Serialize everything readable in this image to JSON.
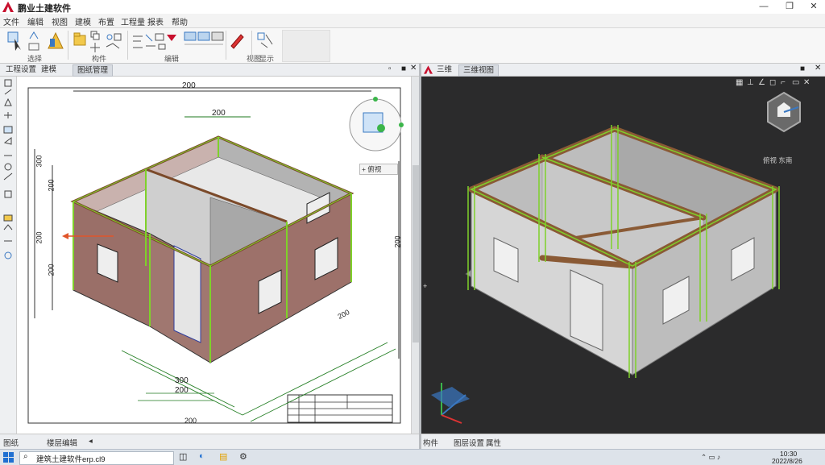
{
  "window": {
    "title": "鹏业土建软件"
  },
  "menu": [
    "文件",
    "编辑",
    "视图",
    "建模",
    "布置",
    "工程量",
    "报表",
    "帮助"
  ],
  "ribbon": {
    "group_labels": [
      "选择",
      "构件",
      "编辑",
      "视图",
      "显示"
    ]
  },
  "left_panel": {
    "tabs": [
      "工程设置",
      "建模",
      "图纸管理"
    ],
    "drawing": {
      "dims": [
        "200",
        "200",
        "300",
        "200",
        "200",
        "200",
        "200",
        "300",
        "200",
        "200",
        "200"
      ],
      "view_label": "+ 俯视"
    },
    "status": [
      "图纸",
      "楼层编辑"
    ]
  },
  "right_panel": {
    "tabs": [
      "三维",
      "三维视图"
    ],
    "view_label": "俯视 东南",
    "status": [
      "构件",
      "图层设置",
      "属性"
    ]
  },
  "taskbar": {
    "search": "建筑土建软件erp.cl9",
    "time": "10:30",
    "date": "2022/8/26"
  },
  "colors": {
    "accent": "#c8102e",
    "wall_left": "#9a6f68",
    "wall_right": "#b9b9b9",
    "beam": "#8a5a35",
    "highlight": "#7fd12a"
  }
}
